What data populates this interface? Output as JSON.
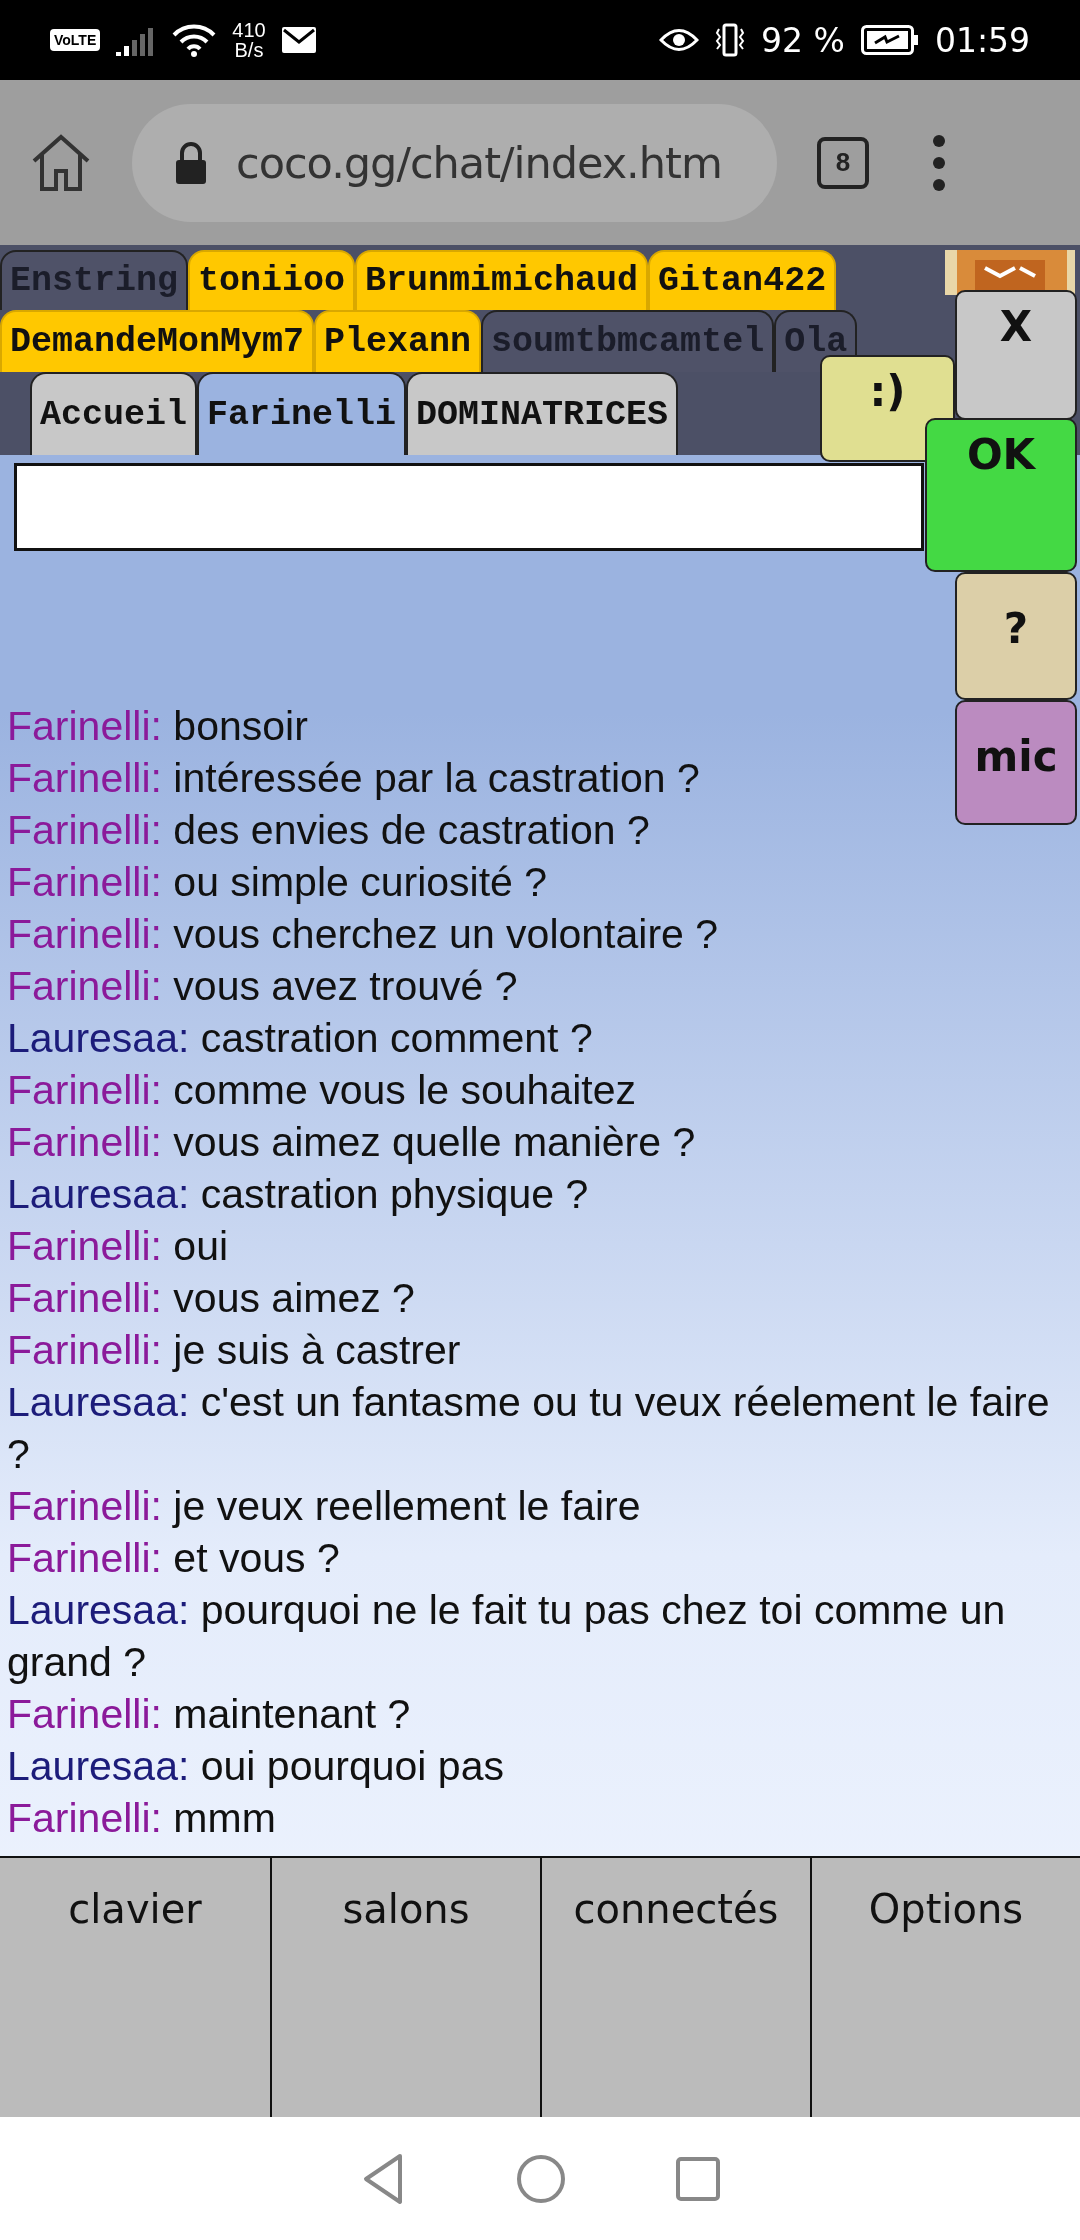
{
  "status_bar": {
    "network_badge": "VoLTE",
    "speed_value": "410",
    "speed_unit": "B/s",
    "battery": "92 %",
    "time": "01:59"
  },
  "browser": {
    "url": "coco.gg/chat/index.htm",
    "tab_count": "8"
  },
  "chat_tabs": [
    [
      {
        "label": "Enstring",
        "highlighted": false,
        "selected": false
      },
      {
        "label": "toniioo",
        "highlighted": true,
        "selected": false
      },
      {
        "label": "Brunmimichaud",
        "highlighted": true,
        "selected": false
      },
      {
        "label": "Gitan422",
        "highlighted": true,
        "selected": false
      }
    ],
    [
      {
        "label": "DemandeMonMym7",
        "highlighted": true,
        "selected": false
      },
      {
        "label": "Plexann",
        "highlighted": true,
        "selected": false
      },
      {
        "label": "soumtbmcamtel",
        "highlighted": false,
        "selected": false
      },
      {
        "label": "Ola",
        "highlighted": false,
        "selected": false
      }
    ],
    [
      {
        "label": "Accueil",
        "highlighted": false,
        "selected": false
      },
      {
        "label": "Farinelli",
        "highlighted": false,
        "selected": true
      },
      {
        "label": "DOMINATRICES",
        "highlighted": false,
        "selected": false
      }
    ]
  ],
  "side_buttons": {
    "smiley": ":)",
    "close": "X",
    "send": "OK",
    "help": "?",
    "mic": "mic"
  },
  "messages": [
    {
      "author": "Farinelli:",
      "color": "#8b1a9a",
      "text": "bonsoir"
    },
    {
      "author": "Farinelli:",
      "color": "#8b1a9a",
      "text": "intéressée par la castration ?"
    },
    {
      "author": "Farinelli:",
      "color": "#8b1a9a",
      "text": "des envies de castration ?"
    },
    {
      "author": "Farinelli:",
      "color": "#8b1a9a",
      "text": "ou simple curiosité ?"
    },
    {
      "author": "Farinelli:",
      "color": "#8b1a9a",
      "text": "vous cherchez un volontaire ?"
    },
    {
      "author": "Farinelli:",
      "color": "#8b1a9a",
      "text": "vous avez trouvé ?"
    },
    {
      "author": "Lauresaa:",
      "color": "#1c1c7a",
      "text": "castration comment ?"
    },
    {
      "author": "Farinelli:",
      "color": "#8b1a9a",
      "text": "comme vous le souhaitez"
    },
    {
      "author": "Farinelli:",
      "color": "#8b1a9a",
      "text": "vous aimez quelle manière ?"
    },
    {
      "author": "Lauresaa:",
      "color": "#1c1c7a",
      "text": "castration physique ?"
    },
    {
      "author": "Farinelli:",
      "color": "#8b1a9a",
      "text": "oui"
    },
    {
      "author": "Farinelli:",
      "color": "#8b1a9a",
      "text": "vous aimez ?"
    },
    {
      "author": "Farinelli:",
      "color": "#8b1a9a",
      "text": "je suis à castrer"
    },
    {
      "author": "Lauresaa:",
      "color": "#1c1c7a",
      "text": "c'est un fantasme ou tu veux réelement le faire ?"
    },
    {
      "author": "Farinelli:",
      "color": "#8b1a9a",
      "text": "je veux reellement le faire"
    },
    {
      "author": "Farinelli:",
      "color": "#8b1a9a",
      "text": "et vous ?"
    },
    {
      "author": "Lauresaa:",
      "color": "#1c1c7a",
      "text": "pourquoi ne le fait tu pas chez toi comme un grand ?"
    },
    {
      "author": "Farinelli:",
      "color": "#8b1a9a",
      "text": "maintenant ?"
    },
    {
      "author": "Lauresaa:",
      "color": "#1c1c7a",
      "text": "oui pourquoi pas"
    },
    {
      "author": "Farinelli:",
      "color": "#8b1a9a",
      "text": "mmm"
    }
  ],
  "bottom_menu": [
    "clavier",
    "salons",
    "connectés",
    "Options"
  ]
}
